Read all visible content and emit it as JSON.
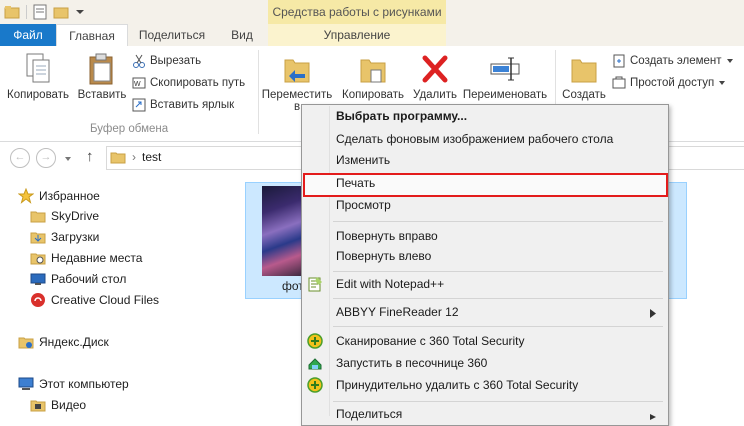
{
  "titlebar": {
    "picture_tools": "Средства работы с рисунками"
  },
  "tabs": {
    "file": "Файл",
    "home": "Главная",
    "share": "Поделиться",
    "view": "Вид",
    "manage": "Управление"
  },
  "ribbon": {
    "copy": "Копировать",
    "paste": "Вставить",
    "cut": "Вырезать",
    "copy_path": "Скопировать путь",
    "paste_shortcut": "Вставить ярлык",
    "clipboard_group": "Буфер обмена",
    "move_to_l1": "Переместить",
    "move_to_l2": "в",
    "copy_to_l1": "Копировать",
    "delete": "Удалить",
    "rename": "Переименовать",
    "new_folder": "Создать",
    "new_item": "Создать элемент",
    "easy_access": "Простой доступ"
  },
  "address": {
    "path": "test"
  },
  "nav": {
    "favorites": "Избранное",
    "skydrive": "SkyDrive",
    "downloads": "Загрузки",
    "recent": "Недавние места",
    "desktop": "Рабочий стол",
    "ccfiles": "Creative Cloud Files",
    "yadisk": "Яндекс.Диск",
    "computer": "Этот компьютер",
    "video": "Видео"
  },
  "file": {
    "label_visible": "фот"
  },
  "context_menu": {
    "open_with": "Выбрать программу...",
    "set_bg": "Сделать фоновым изображением рабочего стола",
    "edit": "Изменить",
    "print": "Печать",
    "preview": "Просмотр",
    "rotate_right": "Повернуть вправо",
    "rotate_left": "Повернуть влево",
    "notepad": "Edit with Notepad++",
    "abbyy": "ABBYY FineReader 12",
    "scan360": "Сканирование с 360 Total Security",
    "sandbox360": "Запустить в песочнице 360",
    "delete360": "Принудительно удалить с  360 Total Security",
    "share": "Поделиться"
  },
  "colors": {
    "file_tab": "#1979ca",
    "tools_tab": "#f6e9a6",
    "selection": "#cce8ff",
    "highlight_border": "#e31b1b"
  }
}
